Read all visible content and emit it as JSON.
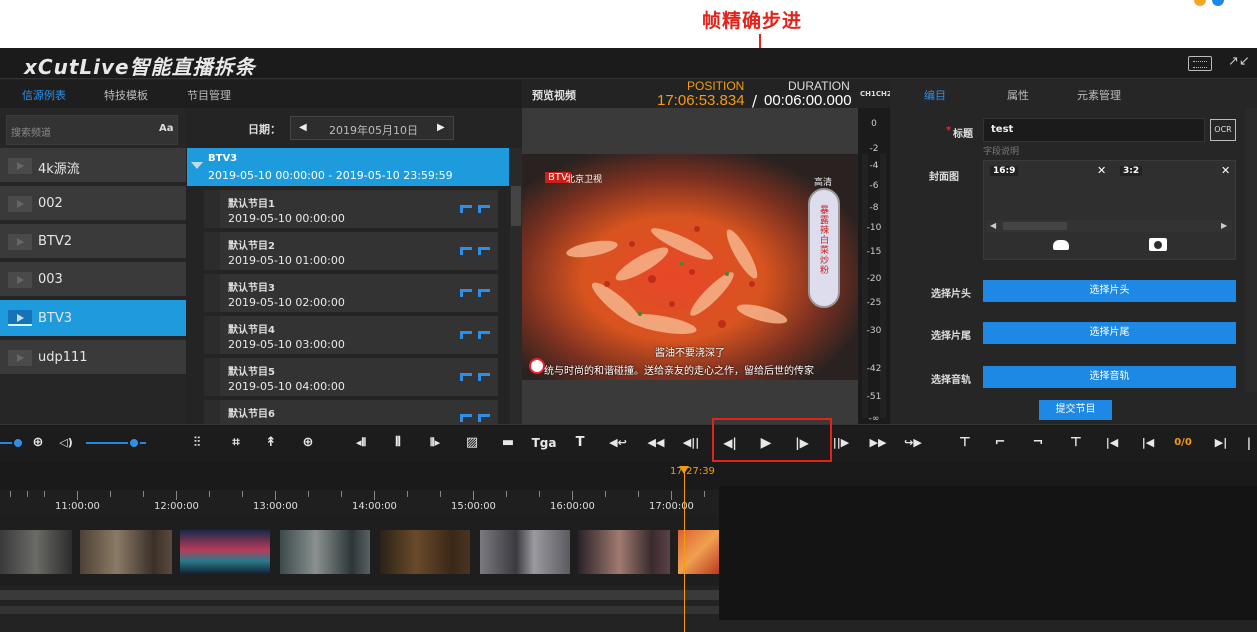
{
  "annotation": {
    "label": "帧精确步进",
    "color": "#e2231a"
  },
  "app": {
    "title": "xCutLive智能直播拆条"
  },
  "left_tabs": [
    "信源例表",
    "特技模板",
    "节目管理"
  ],
  "search": {
    "placeholder": "搜索频道",
    "case_label": "Aa"
  },
  "sources": [
    {
      "label": "4k源流",
      "active": false
    },
    {
      "label": "002",
      "active": false
    },
    {
      "label": "BTV2",
      "active": false
    },
    {
      "label": "003",
      "active": false
    },
    {
      "label": "BTV3",
      "active": true
    },
    {
      "label": "udp111",
      "active": false
    }
  ],
  "date_bar": {
    "label": "日期：",
    "value": "2019年05月10日",
    "prev": "◀",
    "next": "▶"
  },
  "channel": {
    "name": "BTV3",
    "range": "2019-05-10 00:00:00 - 2019-05-10 23:59:59"
  },
  "programs": [
    {
      "title": "默认节目1",
      "time": "2019-05-10 00:00:00"
    },
    {
      "title": "默认节目2",
      "time": "2019-05-10 01:00:00"
    },
    {
      "title": "默认节目3",
      "time": "2019-05-10 02:00:00"
    },
    {
      "title": "默认节目4",
      "time": "2019-05-10 03:00:00"
    },
    {
      "title": "默认节目5",
      "time": "2019-05-10 04:00:00"
    },
    {
      "title": "默认节目6",
      "time": ""
    }
  ],
  "preview": {
    "label": "预览视频",
    "position_label": "POSITION",
    "position_value": "17:06:53.834",
    "separator": "/",
    "duration_label": "DURATION",
    "duration_value": "00:06:00.000",
    "channels_label": "CH1CH2",
    "video": {
      "logo": "BTV",
      "channel": "北京卫视",
      "hot": "高清",
      "scroll_text": "暴露辣白菜炒粉",
      "caption1": "酱油不要浇深了",
      "caption2": "统与时尚的和谐碰撞。送给亲友的走心之作，留给后世的传家"
    }
  },
  "meter_ticks": [
    "0",
    "-2",
    "-4",
    "-6",
    "-8",
    "-10",
    "-15",
    "-20",
    "-25",
    "-30",
    "-42",
    "-51",
    "-∞"
  ],
  "right_tabs": [
    "编目",
    "属性",
    "元素管理"
  ],
  "meta_form": {
    "title_label": "标题",
    "title_required": "*",
    "title_value": "test",
    "title_hint": "字段说明",
    "ocr_label": "OCR",
    "cover_label": "封面图",
    "cover_thumbs": [
      {
        "ratio": "16:9"
      },
      {
        "ratio": "3:2"
      }
    ],
    "close": "✕",
    "scroll_left": "◀",
    "scroll_right": "▶",
    "head_label": "选择片头",
    "head_button": "选择片头",
    "tail_label": "选择片尾",
    "tail_button": "选择片尾",
    "audio_label": "选择音轨",
    "audio_button": "选择音轨",
    "submit": "提交节目"
  },
  "toolbar": {
    "zoom_icon": "⊕",
    "volume_icon": "◁)",
    "tools": [
      {
        "name": "mixer",
        "glyph": "⫶⫶"
      },
      {
        "name": "crop",
        "glyph": "⌗"
      },
      {
        "name": "flip-h",
        "glyph": "↟"
      },
      {
        "name": "flip-v",
        "glyph": "⊕"
      },
      {
        "name": "shrink",
        "glyph": "◂⦀"
      },
      {
        "name": "split",
        "glyph": "⦀"
      },
      {
        "name": "extend",
        "glyph": "⦀▸"
      },
      {
        "name": "hatch",
        "glyph": "▨"
      },
      {
        "name": "bar",
        "glyph": "▬"
      },
      {
        "name": "tga",
        "glyph": "Tga"
      },
      {
        "name": "text",
        "glyph": "T"
      },
      {
        "name": "back-to-in",
        "glyph": "◀↩"
      },
      {
        "name": "rewind",
        "glyph": "◀◀"
      },
      {
        "name": "jog-back",
        "glyph": "◀||"
      },
      {
        "name": "frame-back",
        "glyph": "◀|"
      },
      {
        "name": "play",
        "glyph": "▶"
      },
      {
        "name": "frame-forward",
        "glyph": "|▶"
      },
      {
        "name": "jog-forward",
        "glyph": "||▶"
      },
      {
        "name": "fast-forward",
        "glyph": "▶▶"
      },
      {
        "name": "to-out",
        "glyph": "↪▶"
      },
      {
        "name": "marker-add",
        "glyph": "⊤"
      },
      {
        "name": "mark-in",
        "glyph": "⌐"
      },
      {
        "name": "mark-out",
        "glyph": "¬"
      },
      {
        "name": "marker-remove",
        "glyph": "⊤"
      },
      {
        "name": "go-start",
        "glyph": "|◀"
      },
      {
        "name": "go-prev",
        "glyph": "|◀"
      },
      {
        "name": "go-end",
        "glyph": "▶|"
      }
    ],
    "counter": "0/0"
  },
  "timeline": {
    "playhead_time": "17:27:39",
    "ticks": [
      "11:00:00",
      "12:00:00",
      "13:00:00",
      "14:00:00",
      "15:00:00",
      "16:00:00",
      "17:00:00"
    ]
  },
  "colors": {
    "accent": "#1e88e5",
    "selected": "#1d9bdc",
    "timecode": "#f39c12",
    "background": "#232323"
  }
}
